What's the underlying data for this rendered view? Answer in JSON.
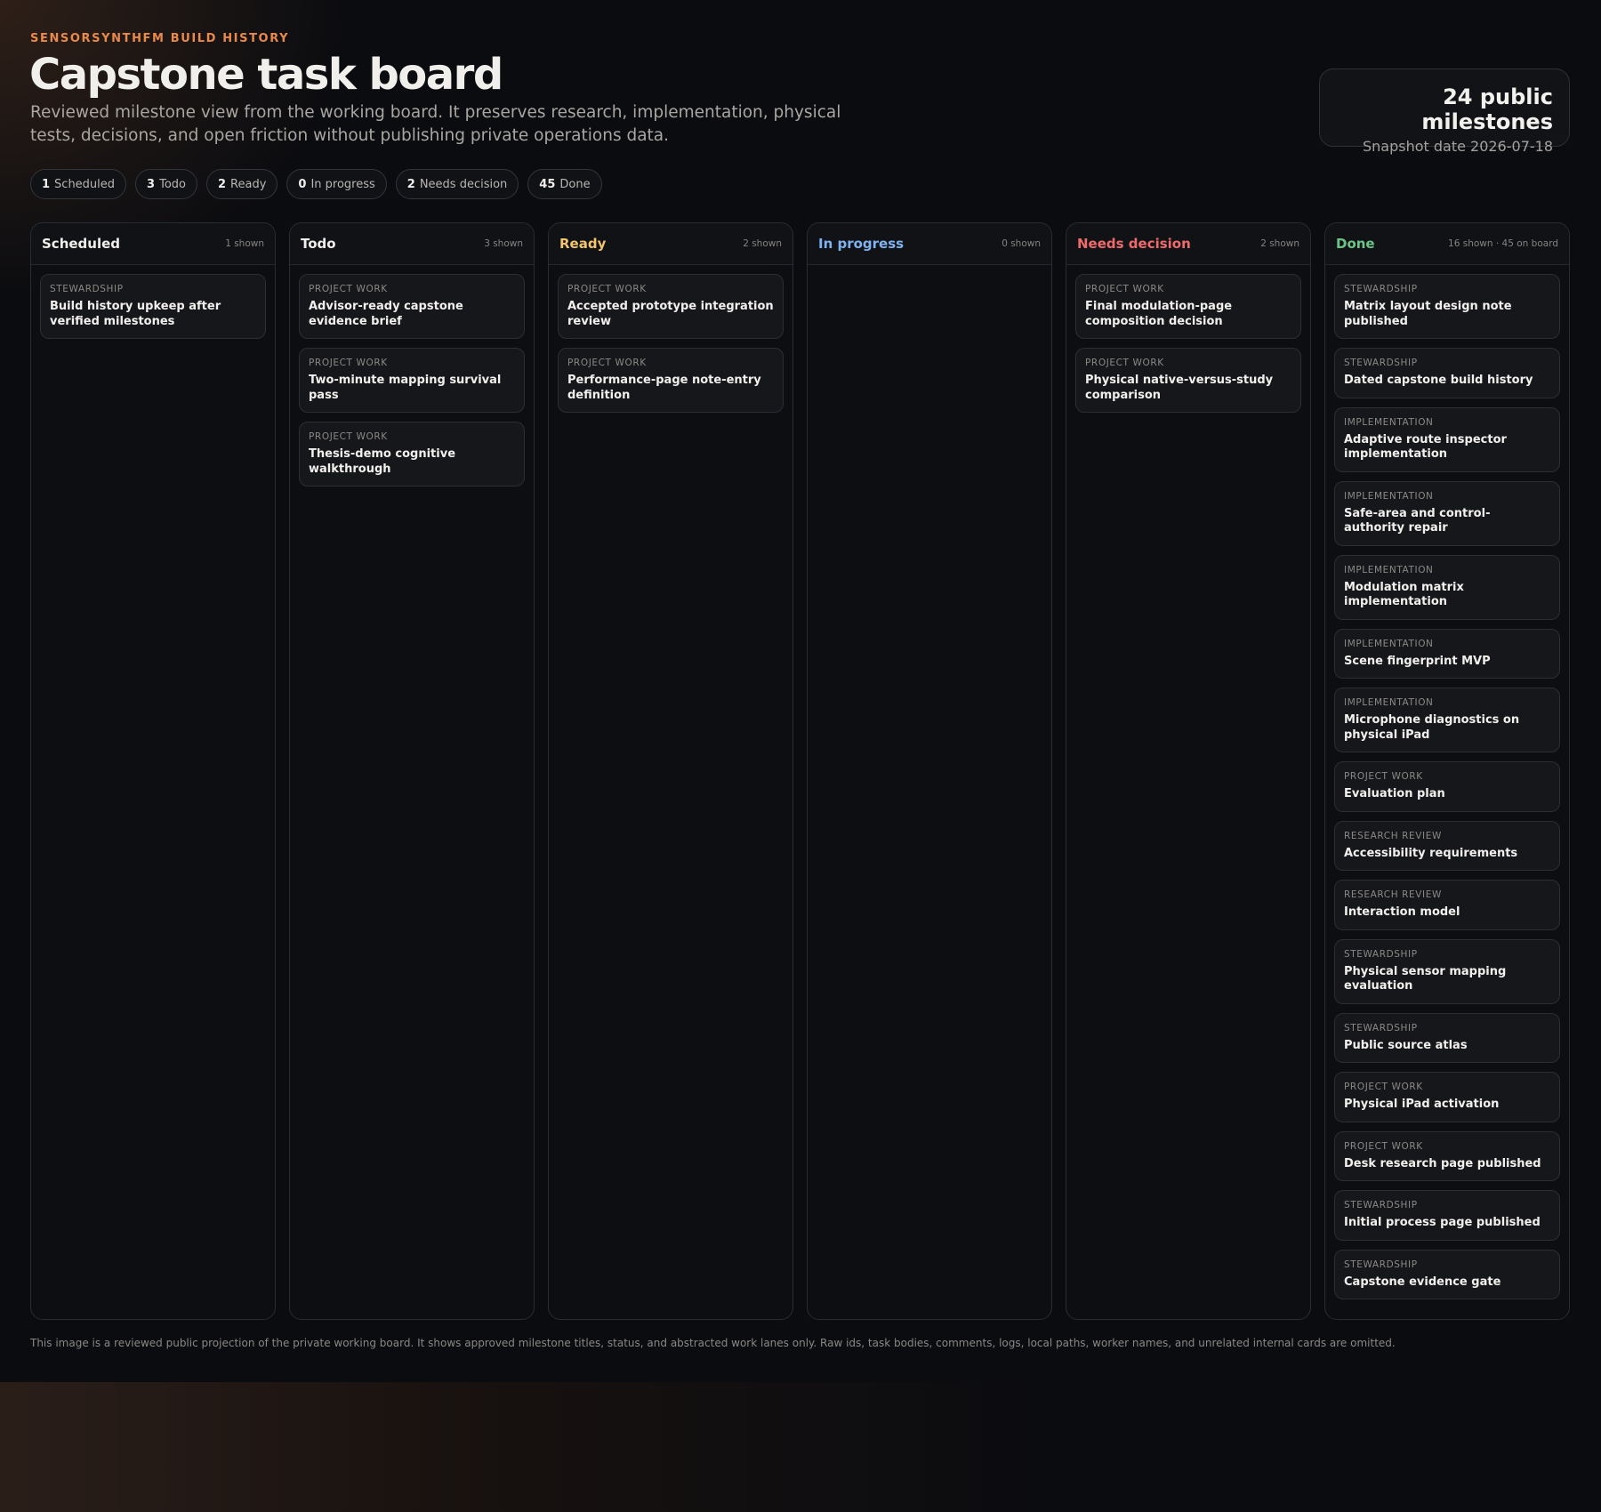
{
  "header": {
    "eyebrow": "SENSORSYNTHFM BUILD HISTORY",
    "title": "Capstone task board",
    "subtitle": "Reviewed milestone view from the working board. It preserves research, implementation, physical tests, decisions, and open friction without publishing private operations data."
  },
  "summary": {
    "count_label": "24 public milestones",
    "date_label": "Snapshot date 2026-07-18"
  },
  "chips": [
    {
      "count": "1",
      "label": "Scheduled"
    },
    {
      "count": "3",
      "label": "Todo"
    },
    {
      "count": "2",
      "label": "Ready"
    },
    {
      "count": "0",
      "label": "In progress"
    },
    {
      "count": "2",
      "label": "Needs decision"
    },
    {
      "count": "45",
      "label": "Done"
    }
  ],
  "columns": [
    {
      "name": "Scheduled",
      "color": "#f1efec",
      "count_label": "1 shown",
      "cards": [
        {
          "lane": "Stewardship",
          "title": "Build history upkeep after verified milestones"
        }
      ]
    },
    {
      "name": "Todo",
      "color": "#f1efec",
      "count_label": "3 shown",
      "cards": [
        {
          "lane": "Project work",
          "title": "Advisor-ready capstone evidence brief"
        },
        {
          "lane": "Project work",
          "title": "Two-minute mapping survival pass"
        },
        {
          "lane": "Project work",
          "title": "Thesis-demo cognitive walkthrough"
        }
      ]
    },
    {
      "name": "Ready",
      "color": "#f2c46d",
      "count_label": "2 shown",
      "cards": [
        {
          "lane": "Project work",
          "title": "Accepted prototype integration review"
        },
        {
          "lane": "Project work",
          "title": "Performance-page note-entry definition"
        }
      ]
    },
    {
      "name": "In progress",
      "color": "#7fb2f0",
      "count_label": "0 shown",
      "cards": []
    },
    {
      "name": "Needs decision",
      "color": "#ef6b6b",
      "count_label": "2 shown",
      "cards": [
        {
          "lane": "Project work",
          "title": "Final modulation-page composition decision"
        },
        {
          "lane": "Project work",
          "title": "Physical native-versus-study comparison"
        }
      ]
    },
    {
      "name": "Done",
      "color": "#6cc586",
      "count_label": "16 shown · 45 on board",
      "cards": [
        {
          "lane": "Stewardship",
          "title": "Matrix layout design note published"
        },
        {
          "lane": "Stewardship",
          "title": "Dated capstone build history"
        },
        {
          "lane": "Implementation",
          "title": "Adaptive route inspector implementation"
        },
        {
          "lane": "Implementation",
          "title": "Safe-area and control-authority repair"
        },
        {
          "lane": "Implementation",
          "title": "Modulation matrix implementation"
        },
        {
          "lane": "Implementation",
          "title": "Scene fingerprint MVP"
        },
        {
          "lane": "Implementation",
          "title": "Microphone diagnostics on physical iPad"
        },
        {
          "lane": "Project work",
          "title": "Evaluation plan"
        },
        {
          "lane": "Research review",
          "title": "Accessibility requirements"
        },
        {
          "lane": "Research review",
          "title": "Interaction model"
        },
        {
          "lane": "Stewardship",
          "title": "Physical sensor mapping evaluation"
        },
        {
          "lane": "Stewardship",
          "title": "Public source atlas"
        },
        {
          "lane": "Project work",
          "title": "Physical iPad activation"
        },
        {
          "lane": "Project work",
          "title": "Desk research page published"
        },
        {
          "lane": "Stewardship",
          "title": "Initial process page published"
        },
        {
          "lane": "Stewardship",
          "title": "Capstone evidence gate"
        }
      ]
    }
  ],
  "footnote": "This image is a reviewed public projection of the private working board. It shows approved milestone titles, status, and abstracted work lanes only. Raw ids, task bodies, comments, logs, local paths, worker names, and unrelated internal cards are omitted."
}
